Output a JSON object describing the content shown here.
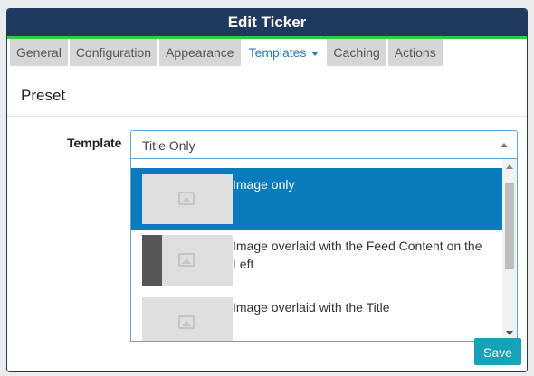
{
  "modal": {
    "title": "Edit Ticker"
  },
  "tabs": [
    {
      "label": "General"
    },
    {
      "label": "Configuration"
    },
    {
      "label": "Appearance"
    },
    {
      "label": "Templates"
    },
    {
      "label": "Caching"
    },
    {
      "label": "Actions"
    }
  ],
  "active_tab": "Templates",
  "section": {
    "title": "Preset"
  },
  "template_field": {
    "label": "Template",
    "value": "Title Only",
    "options": [
      {
        "label": "Image only",
        "selected": true,
        "thumb_icon": "image-placeholder-icon"
      },
      {
        "label": "Image overlaid with the Feed Content on the Left",
        "selected": false,
        "thumb_icon": "image-placeholder-icon"
      },
      {
        "label": "Image overlaid with the Title",
        "selected": false,
        "thumb_icon": "image-placeholder-icon"
      }
    ]
  },
  "footer": {
    "save_label": "Save"
  },
  "colors": {
    "header_bg": "#1f3a5f",
    "header_accent": "#2ecc40",
    "selected_option": "#0a7bbd",
    "save_button": "#16a2b8"
  }
}
